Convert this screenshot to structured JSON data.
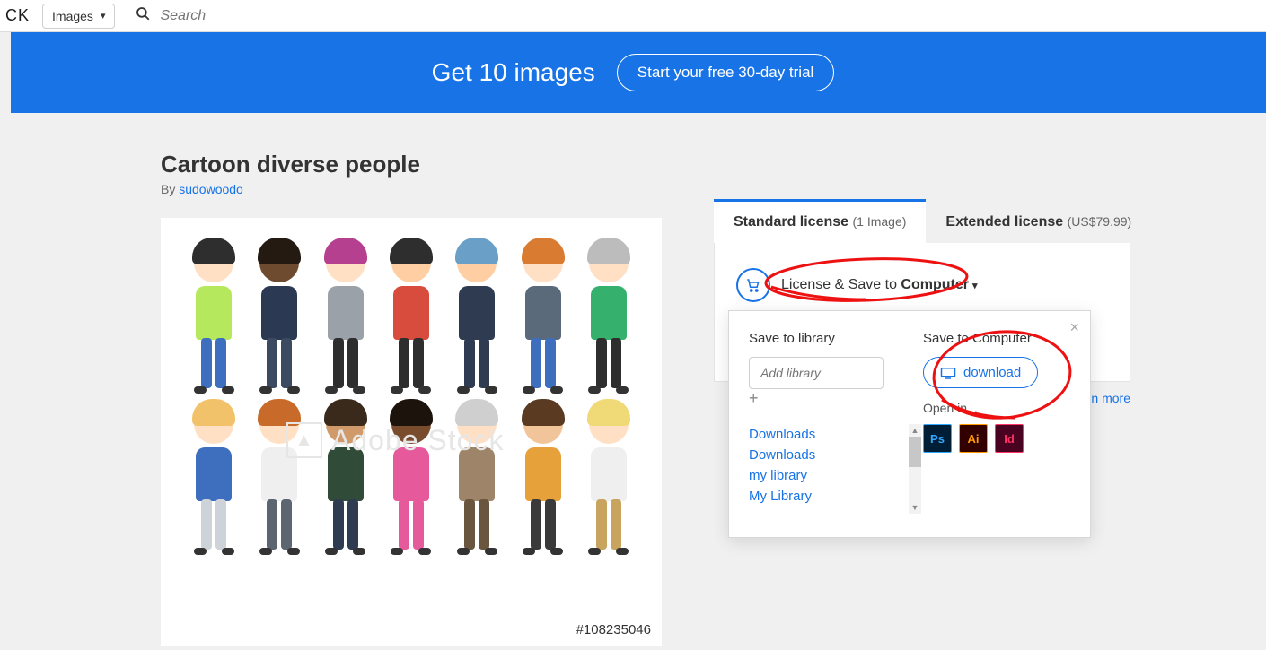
{
  "topbar": {
    "brand": "CK",
    "category": "Images",
    "search_placeholder": "Search"
  },
  "banner": {
    "text": "Get 10 images",
    "cta": "Start your free 30-day trial"
  },
  "asset": {
    "title": "Cartoon diverse people",
    "by_label": "By ",
    "author": "sudowoodo",
    "watermark": "Adobe Stock",
    "id": "#108235046"
  },
  "tabs": {
    "standard_label": "Standard license",
    "standard_sub": "(1 Image)",
    "extended_label": "Extended license",
    "extended_sub": "(US$79.99)"
  },
  "license": {
    "text": "License & Save to",
    "destination": "Computer"
  },
  "popup": {
    "save_to_library": "Save to library",
    "save_to_computer": "Save to Computer",
    "add_library_placeholder": "Add library",
    "plus": "+",
    "libraries": [
      "Downloads",
      "Downloads",
      "my library",
      "My Library"
    ],
    "download": "download",
    "open_in": "Open in...",
    "apps": {
      "ps": "Ps",
      "ai": "Ai",
      "id": "Id"
    }
  },
  "misc": {
    "learn_more": "n more"
  },
  "people": {
    "row1": [
      {
        "hair": "#2e2e2e",
        "skin": "#ffe0c4",
        "shirt": "#b6e85e",
        "pants": "#3e6fbf"
      },
      {
        "hair": "#241a12",
        "skin": "#6e4a2e",
        "shirt": "#2b3a52",
        "pants": "#3b4a60"
      },
      {
        "hair": "#b4408f",
        "skin": "#ffe0c4",
        "shirt": "#9aa1a8",
        "pants": "#2e2e2e"
      },
      {
        "hair": "#2e2e2e",
        "skin": "#ffcfa3",
        "shirt": "#d84c3d",
        "pants": "#2e2e2e"
      },
      {
        "hair": "#6aa0c7",
        "skin": "#ffcfa3",
        "shirt": "#2e3b50",
        "pants": "#2e3b50"
      },
      {
        "hair": "#d97b30",
        "skin": "#ffe0c4",
        "shirt": "#5a6a7a",
        "pants": "#3e6fbf"
      },
      {
        "hair": "#bcbcbc",
        "skin": "#ffe0c4",
        "shirt": "#36b06d",
        "pants": "#2e2e2e"
      }
    ],
    "row2": [
      {
        "hair": "#f2c26b",
        "skin": "#ffe0c4",
        "shirt": "#3e6fbf",
        "pants": "#cdd3d8"
      },
      {
        "hair": "#c86a2a",
        "skin": "#ffe0c4",
        "shirt": "#efefef",
        "pants": "#5b6670"
      },
      {
        "hair": "#3a2a1c",
        "skin": "#d19a6a",
        "shirt": "#304c38",
        "pants": "#2e3b50"
      },
      {
        "hair": "#1d130d",
        "skin": "#7a4c2e",
        "shirt": "#e65a9c",
        "pants": "#e65a9c"
      },
      {
        "hair": "#cfcfcf",
        "skin": "#ffe0c4",
        "shirt": "#9e8468",
        "pants": "#6a563e"
      },
      {
        "hair": "#5a3a20",
        "skin": "#f2c49a",
        "shirt": "#e6a13a",
        "pants": "#3a3a3a"
      },
      {
        "hair": "#f0d977",
        "skin": "#ffe0c4",
        "shirt": "#efefef",
        "pants": "#c8a45e"
      }
    ]
  }
}
